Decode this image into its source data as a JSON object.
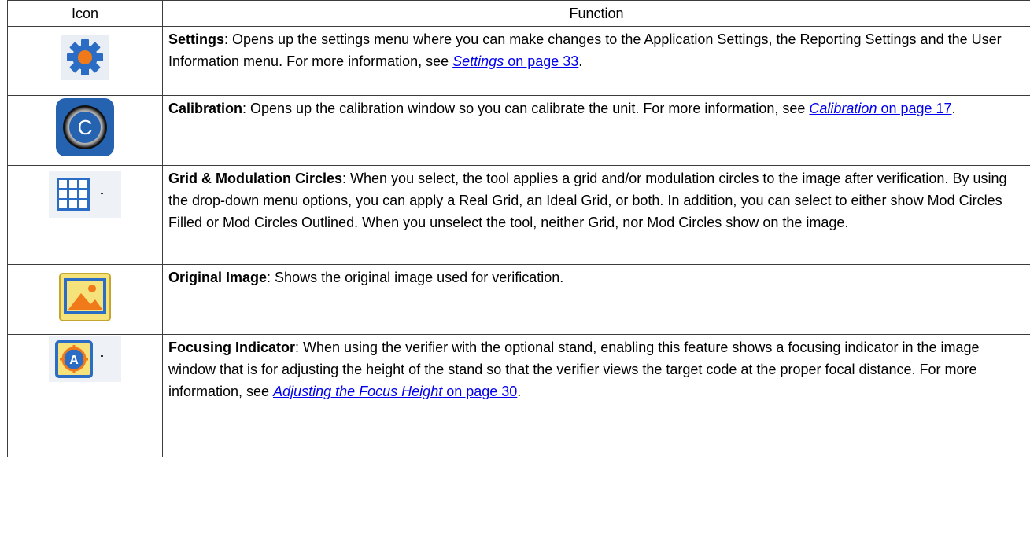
{
  "table": {
    "header_icon": "Icon",
    "header_function": "Function",
    "rows": [
      {
        "icon": "gear-icon",
        "term": "Settings",
        "text": ": Opens up the settings menu where you can make changes to the Application Settings, the Reporting Settings and the User Information menu. For more information, see ",
        "link_title": "Settings",
        "link_page": " on page 33",
        "tail": "."
      },
      {
        "icon": "calibration-icon",
        "term": "Calibration",
        "text": ": Opens up the calibration window so you can calibrate the unit. For more information, see ",
        "link_title": "Calibration",
        "link_page": " on page 17",
        "tail": "."
      },
      {
        "icon": "grid-icon",
        "term": "Grid & Modulation Circles",
        "text": ": When you select, the tool applies a grid and/or modulation circles to the image after verification. By using the drop-down menu options, you can apply a Real Grid, an Ideal Grid, or both. In addition, you can select to either show Mod Circles Filled or Mod Circles Outlined. When you unselect the tool, neither Grid, nor Mod Circles show on the image."
      },
      {
        "icon": "image-icon",
        "term": "Original Image",
        "text": ": Shows the original image used for verification."
      },
      {
        "icon": "focus-target-icon",
        "term": "Focusing Indicator",
        "text": ": When using the verifier with the optional stand, enabling this feature shows a focusing indicator in the image window that is for adjusting the height of the stand so that the verifier views the target code at the proper focal distance. For more information, see ",
        "link_title": "Adjusting the Focus Height",
        "link_page": " on page 30",
        "tail": "."
      }
    ]
  },
  "colors": {
    "link": "#0000ee",
    "border": "#3c3c3c",
    "icon_blue": "#2b6cc4",
    "icon_orange": "#f07a1a"
  }
}
